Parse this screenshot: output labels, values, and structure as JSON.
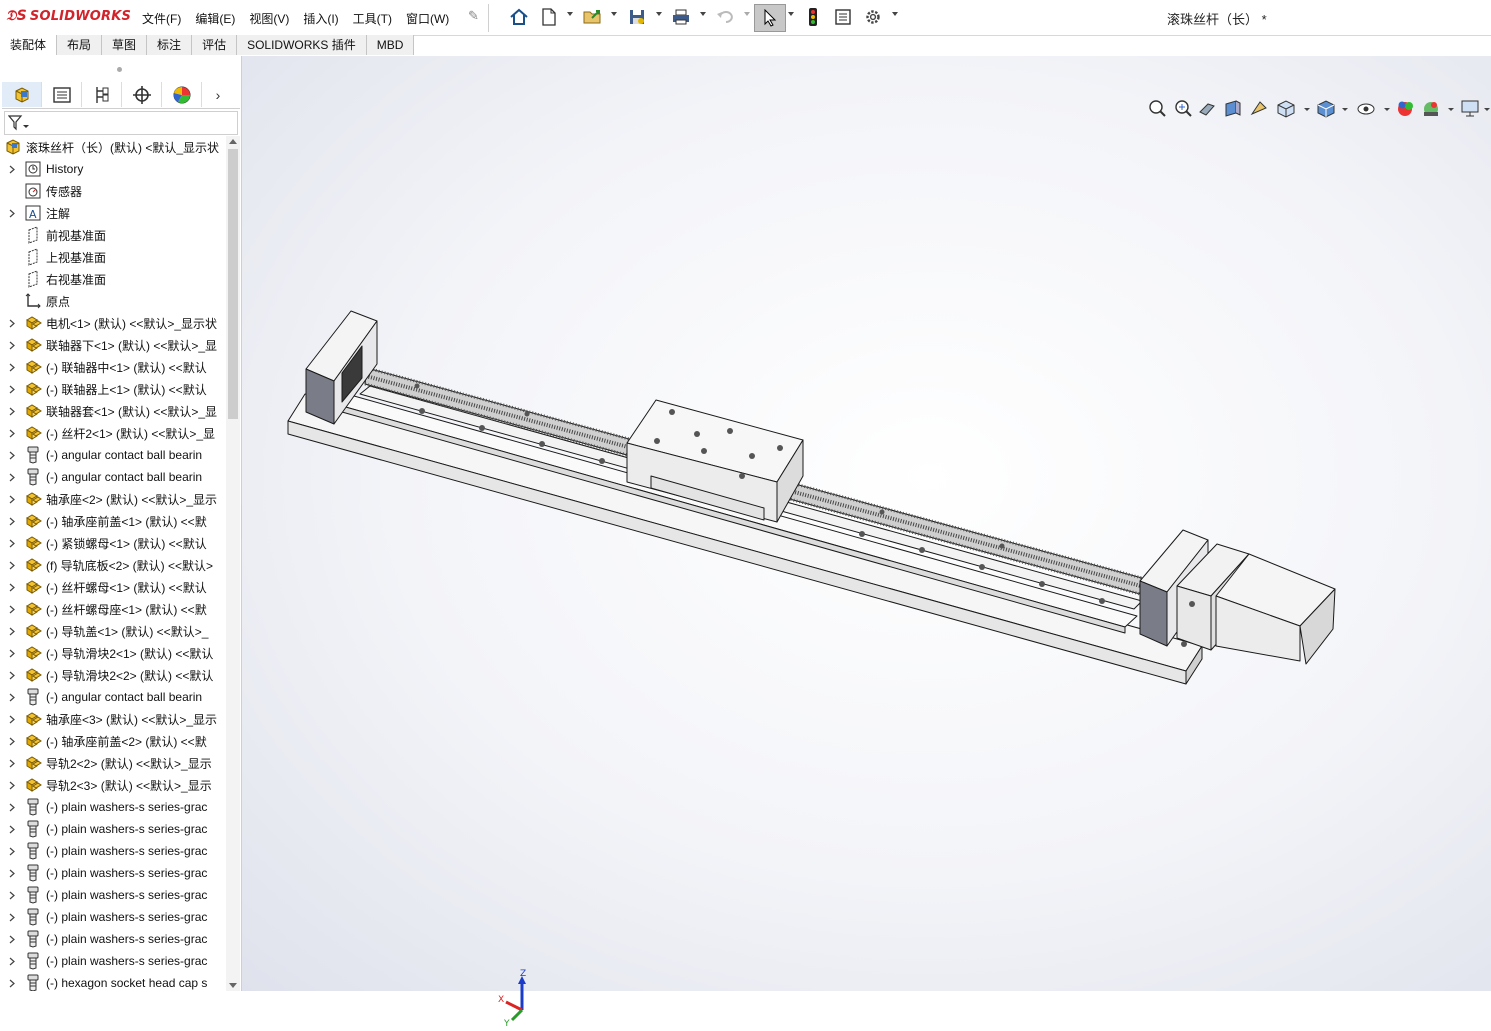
{
  "app": {
    "logo": "SOLIDWORKS",
    "document_title": "滚珠丝杆（长） *"
  },
  "menu": [
    "文件(F)",
    "编辑(E)",
    "视图(V)",
    "插入(I)",
    "工具(T)",
    "窗口(W)"
  ],
  "command_tabs": [
    "装配体",
    "布局",
    "草图",
    "标注",
    "评估",
    "SOLIDWORKS 插件",
    "MBD"
  ],
  "command_tabs_active": "装配体",
  "tree": {
    "root": "滚珠丝杆（长）(默认) <默认_显示状",
    "items": [
      {
        "label": "History",
        "icon": "history-icon",
        "expandable": true
      },
      {
        "label": "传感器",
        "icon": "sensor-icon",
        "expandable": false
      },
      {
        "label": "注解",
        "icon": "annotation-icon",
        "expandable": true
      },
      {
        "label": "前视基准面",
        "icon": "plane-icon",
        "expandable": false
      },
      {
        "label": "上视基准面",
        "icon": "plane-icon",
        "expandable": false
      },
      {
        "label": "右视基准面",
        "icon": "plane-icon",
        "expandable": false
      },
      {
        "label": "原点",
        "icon": "origin-icon",
        "expandable": false
      },
      {
        "label": "电机<1> (默认) <<默认>_显示状",
        "icon": "assembly-icon",
        "expandable": true
      },
      {
        "label": "联轴器下<1> (默认) <<默认>_显",
        "icon": "assembly-icon",
        "expandable": true
      },
      {
        "label": "(-) 联轴器中<1> (默认) <<默认",
        "icon": "assembly-icon",
        "expandable": true
      },
      {
        "label": "(-) 联轴器上<1> (默认) <<默认",
        "icon": "assembly-icon",
        "expandable": true
      },
      {
        "label": "联轴器套<1> (默认) <<默认>_显",
        "icon": "assembly-icon",
        "expandable": true
      },
      {
        "label": "(-) 丝杆2<1> (默认) <<默认>_显",
        "icon": "assembly-icon",
        "expandable": true
      },
      {
        "label": "(-) angular contact ball bearin",
        "icon": "toolbox-part-icon",
        "expandable": true
      },
      {
        "label": "(-) angular contact ball bearin",
        "icon": "toolbox-part-icon",
        "expandable": true
      },
      {
        "label": "轴承座<2> (默认) <<默认>_显示",
        "icon": "assembly-icon",
        "expandable": true
      },
      {
        "label": "(-) 轴承座前盖<1> (默认) <<默",
        "icon": "assembly-icon",
        "expandable": true
      },
      {
        "label": "(-) 紧锁螺母<1> (默认) <<默认",
        "icon": "assembly-icon",
        "expandable": true
      },
      {
        "label": "(f) 导轨底板<2> (默认) <<默认>",
        "icon": "assembly-icon",
        "expandable": true
      },
      {
        "label": "(-) 丝杆螺母<1> (默认) <<默认",
        "icon": "assembly-icon",
        "expandable": true
      },
      {
        "label": "(-) 丝杆螺母座<1> (默认) <<默",
        "icon": "assembly-icon",
        "expandable": true
      },
      {
        "label": "(-) 导轨盖<1> (默认) <<默认>_",
        "icon": "assembly-icon",
        "expandable": true
      },
      {
        "label": "(-) 导轨滑块2<1> (默认) <<默认",
        "icon": "assembly-icon",
        "expandable": true
      },
      {
        "label": "(-) 导轨滑块2<2> (默认) <<默认",
        "icon": "assembly-icon",
        "expandable": true
      },
      {
        "label": "(-) angular contact ball bearin",
        "icon": "toolbox-part-icon",
        "expandable": true
      },
      {
        "label": "轴承座<3> (默认) <<默认>_显示",
        "icon": "assembly-icon",
        "expandable": true
      },
      {
        "label": "(-) 轴承座前盖<2> (默认) <<默",
        "icon": "assembly-icon",
        "expandable": true
      },
      {
        "label": "导轨2<2> (默认) <<默认>_显示",
        "icon": "assembly-icon",
        "expandable": true
      },
      {
        "label": "导轨2<3> (默认) <<默认>_显示",
        "icon": "assembly-icon",
        "expandable": true
      },
      {
        "label": "(-) plain washers-s series-grac",
        "icon": "toolbox-part-icon",
        "expandable": true
      },
      {
        "label": "(-) plain washers-s series-grac",
        "icon": "toolbox-part-icon",
        "expandable": true
      },
      {
        "label": "(-) plain washers-s series-grac",
        "icon": "toolbox-part-icon",
        "expandable": true
      },
      {
        "label": "(-) plain washers-s series-grac",
        "icon": "toolbox-part-icon",
        "expandable": true
      },
      {
        "label": "(-) plain washers-s series-grac",
        "icon": "toolbox-part-icon",
        "expandable": true
      },
      {
        "label": "(-) plain washers-s series-grac",
        "icon": "toolbox-part-icon",
        "expandable": true
      },
      {
        "label": "(-) plain washers-s series-grac",
        "icon": "toolbox-part-icon",
        "expandable": true
      },
      {
        "label": "(-) plain washers-s series-grac",
        "icon": "toolbox-part-icon",
        "expandable": true
      },
      {
        "label": "(-) hexagon socket head cap s",
        "icon": "toolbox-part-icon",
        "expandable": true
      }
    ]
  },
  "triad": {
    "x": "X",
    "y": "Y",
    "z": "Z"
  },
  "colors": {
    "accent": "#d2232a",
    "model_edge": "#1a1a1a",
    "model_face": "#f4f4f4",
    "selected_tab": "#e2ecf8"
  }
}
